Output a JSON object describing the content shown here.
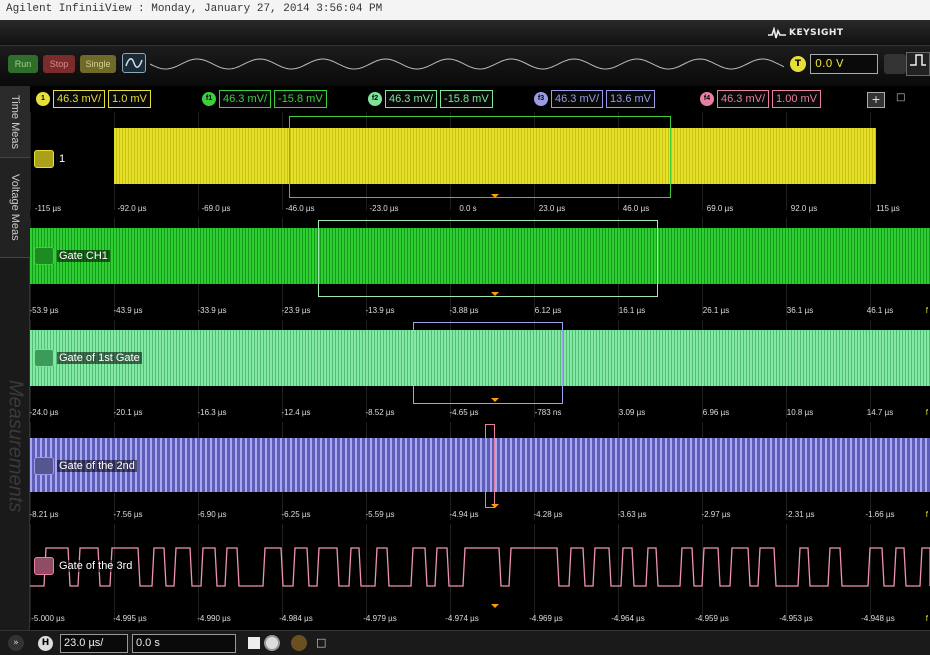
{
  "window": {
    "title": "Agilent InfiniiView : Monday, January 27, 2014 3:56:04 PM",
    "brand": "KEYSIGHT"
  },
  "controls": {
    "run_label": "Run",
    "stop_label": "Stop",
    "single_label": "Single",
    "trigger_badge": "T",
    "trigger_level": "0.0 V"
  },
  "channels": [
    {
      "badge": "1",
      "scale": "46.3 mV/",
      "offset": "1.0 mV",
      "color": "#e6df3a"
    },
    {
      "badge": "f1",
      "scale": "46.3 mV/",
      "offset": "-15.8 mV",
      "color": "#3ccf3c"
    },
    {
      "badge": "f2",
      "scale": "46.3 mV/",
      "offset": "-15.8 mV",
      "color": "#7fe39a"
    },
    {
      "badge": "f3",
      "scale": "46.3 mV/",
      "offset": "13.6 mV",
      "color": "#9a9ae6"
    },
    {
      "badge": "f4",
      "scale": "46.3 mV/",
      "offset": "1.00 mV",
      "color": "#e87fa5"
    }
  ],
  "left_tabs": {
    "time": "Time Meas",
    "voltage": "Voltage Meas",
    "measurements": "Measurements"
  },
  "panels": [
    {
      "label": "1",
      "color": "#dede1a",
      "ticks": [
        "-115 µs",
        "-92.0 µs",
        "-69.0 µs",
        "-46.0 µs",
        "-23.0 µs",
        "0.0 s",
        "23.0 µs",
        "46.0 µs",
        "69.0 µs",
        "92.0 µs",
        "115 µs"
      ],
      "trailing": ""
    },
    {
      "label": "Gate CH1",
      "color": "#22c02a",
      "ticks": [
        "-53.9 µs",
        "-43.9 µs",
        "-33.9 µs",
        "-23.9 µs",
        "-13.9 µs",
        "-3.88 µs",
        "6.12 µs",
        "16.1 µs",
        "26.1 µs",
        "36.1 µs",
        "46.1 µs"
      ],
      "trailing": "f"
    },
    {
      "label": "Gate of 1st Gate",
      "color": "#7ee3a0",
      "ticks": [
        "-24.0 µs",
        "-20.1 µs",
        "-16.3 µs",
        "-12.4 µs",
        "-8.52 µs",
        "-4.65 µs",
        "-783 ns",
        "3.09 µs",
        "6.96 µs",
        "10.8 µs",
        "14.7 µs"
      ],
      "trailing": "f"
    },
    {
      "label": "Gate of the 2nd",
      "color": "#9a9ae6",
      "ticks": [
        "-8.21 µs",
        "-7.56 µs",
        "-6.90 µs",
        "-6.25 µs",
        "-5.59 µs",
        "-4.94 µs",
        "-4.28 µs",
        "-3.63 µs",
        "-2.97 µs",
        "-2.31 µs",
        "-1.66 µs"
      ],
      "trailing": "f"
    },
    {
      "label": "Gate of the 3rd",
      "color": "#e87fa5",
      "ticks": [
        "-5.000 µs",
        "-4.995 µs",
        "-4.990 µs",
        "-4.984 µs",
        "-4.979 µs",
        "-4.974 µs",
        "-4.969 µs",
        "-4.964 µs",
        "-4.959 µs",
        "-4.953 µs",
        "-4.948 µs"
      ],
      "trailing": "f"
    }
  ],
  "timebase": {
    "badge": "H",
    "scale": "23.0 µs/",
    "position": "0.0 s"
  }
}
